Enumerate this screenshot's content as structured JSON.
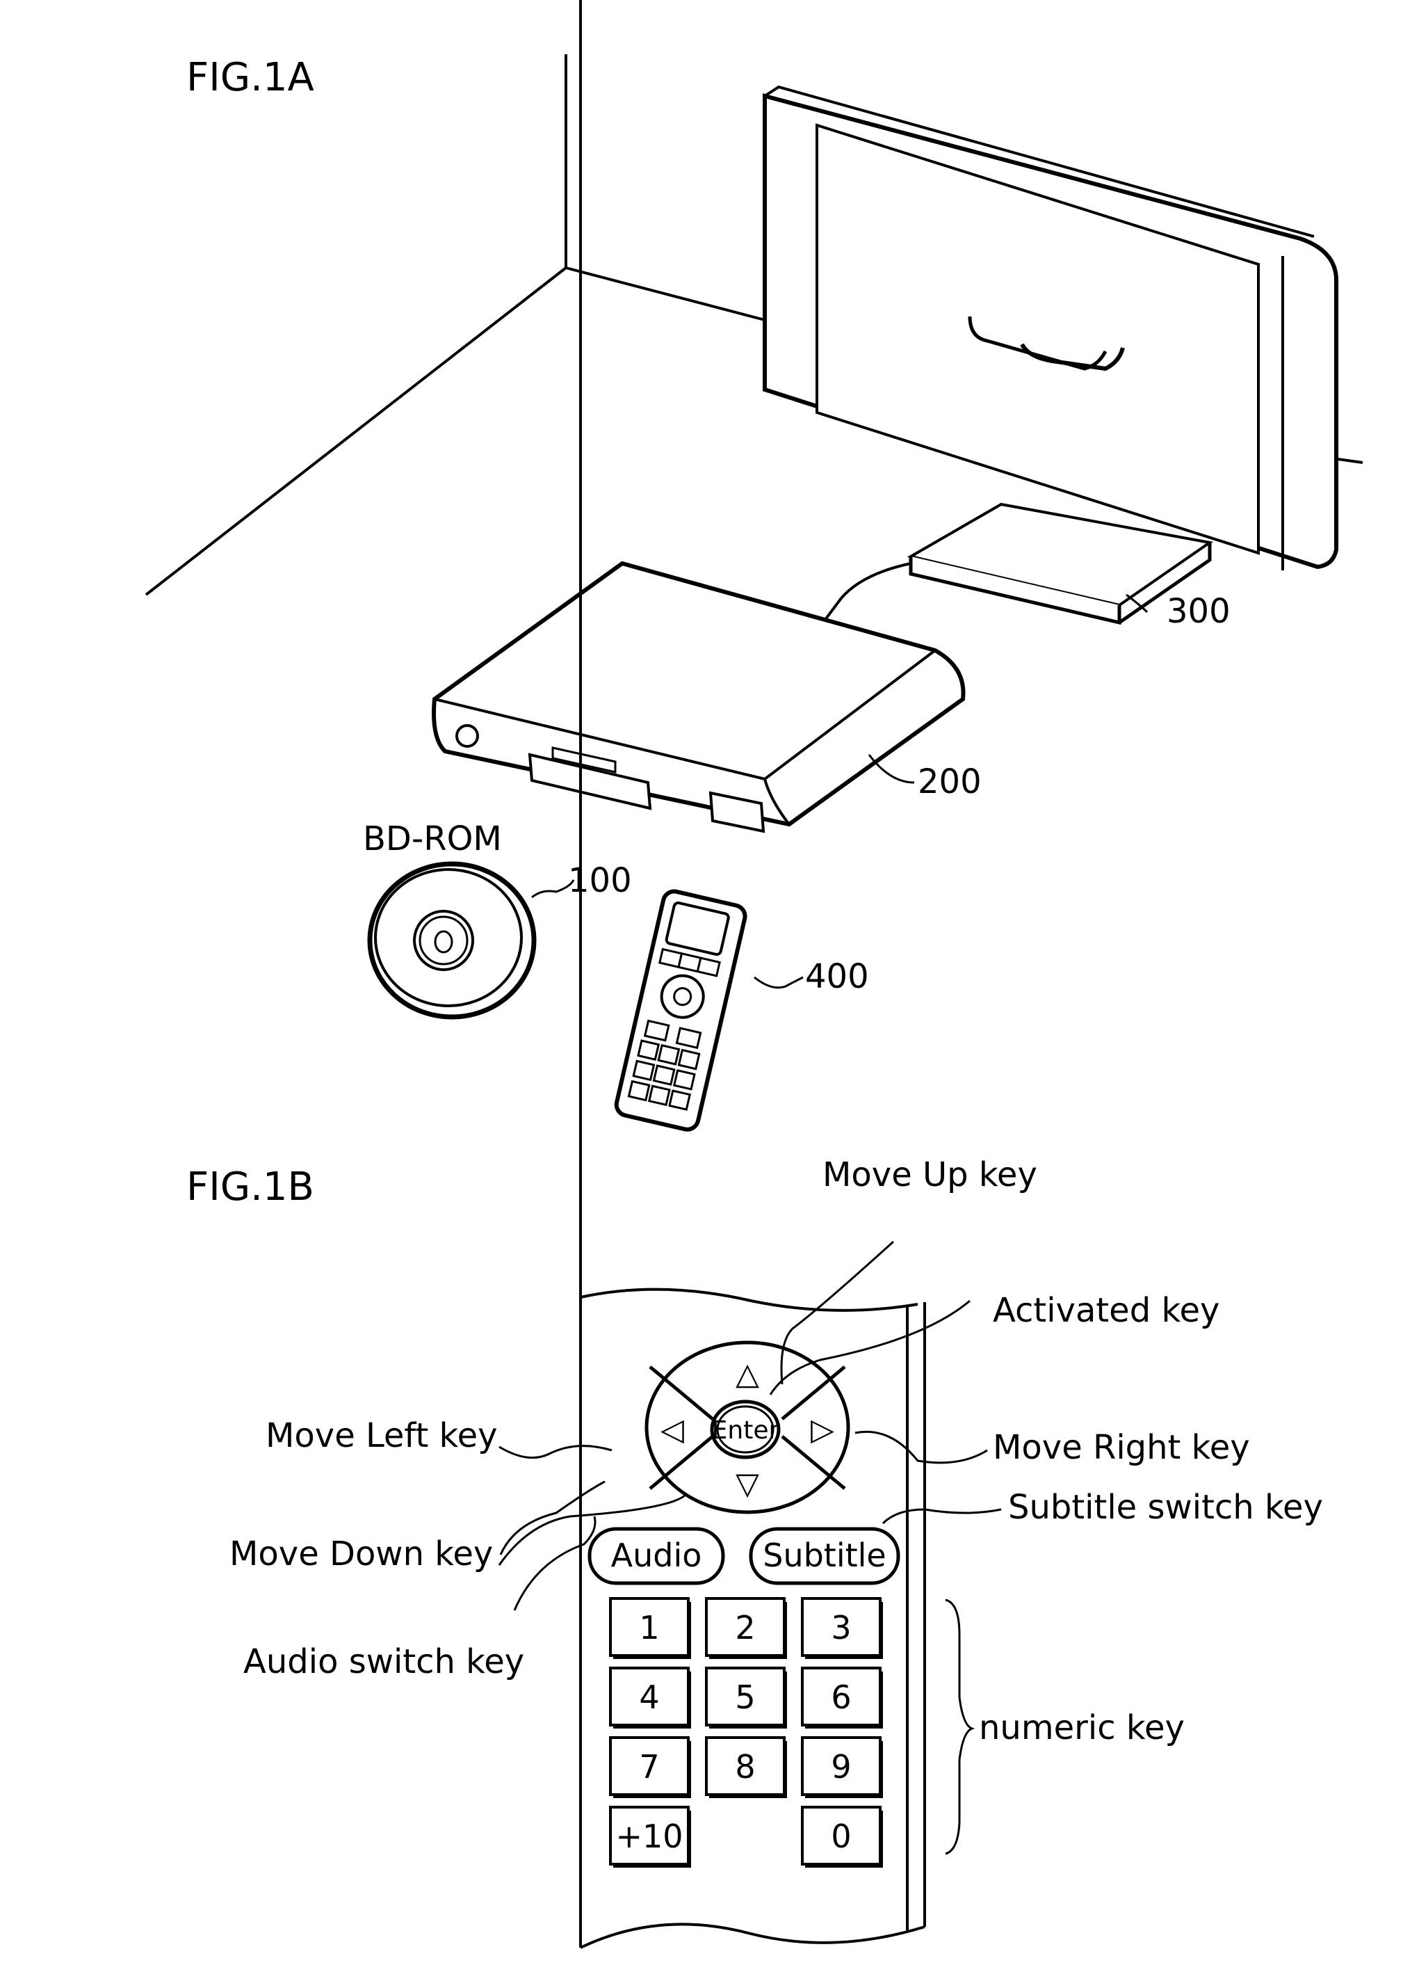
{
  "figure_1a": {
    "title": "FIG.1A",
    "labels": {
      "disc_name": "BD-ROM",
      "disc_ref": "100",
      "player_ref": "200",
      "tv_ref": "300",
      "remote_ref": "400"
    }
  },
  "figure_1b": {
    "title": "FIG.1B",
    "callouts": {
      "move_up": "Move Up key",
      "activated": "Activated key",
      "move_left": "Move Left key",
      "move_right": "Move Right key",
      "move_down": "Move Down key",
      "subtitle_switch": "Subtitle switch key",
      "audio_switch": "Audio switch key",
      "numeric": "numeric key"
    },
    "remote": {
      "enter_label": "Enter",
      "arrow_up": "△",
      "arrow_down": "▽",
      "arrow_left": "◁",
      "arrow_right": "▷",
      "audio_label": "Audio",
      "subtitle_label": "Subtitle",
      "numeric_keys": [
        "1",
        "2",
        "3",
        "4",
        "5",
        "6",
        "7",
        "8",
        "9",
        "+10",
        "0"
      ]
    }
  }
}
